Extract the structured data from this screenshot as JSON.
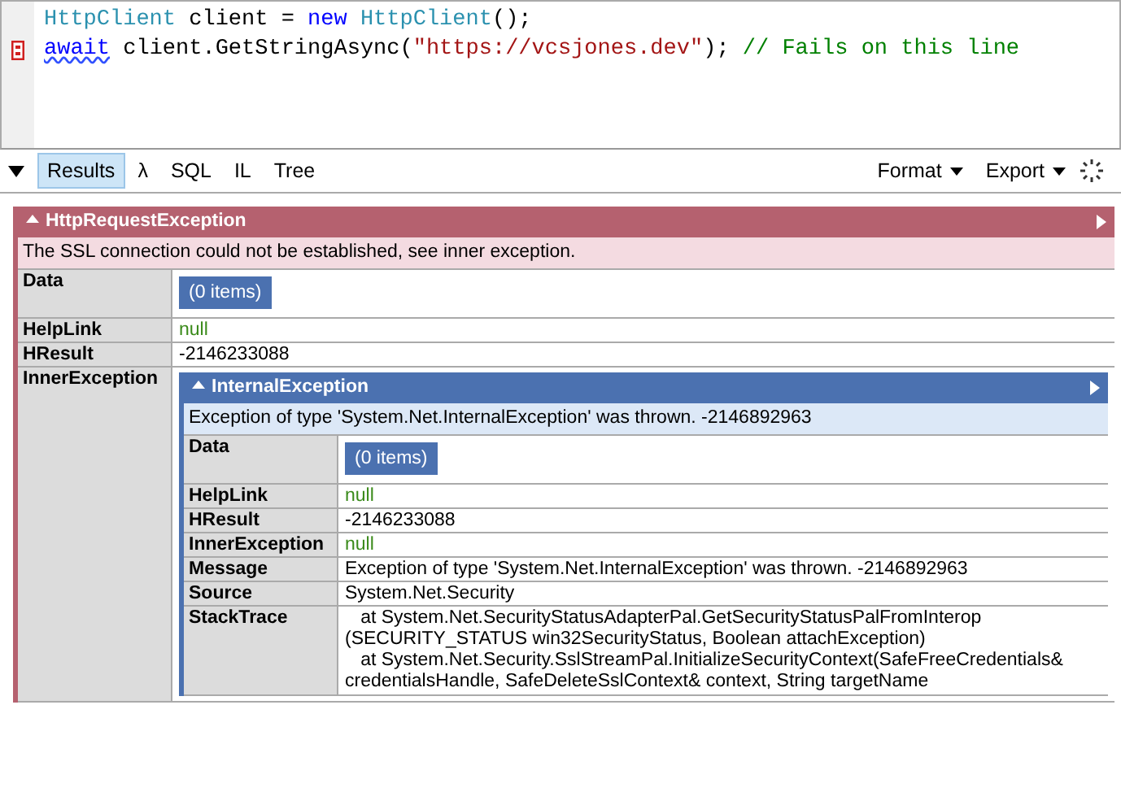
{
  "editor": {
    "lines": [
      {
        "breakpoint": false,
        "tokens": [
          {
            "text": "HttpClient",
            "kind": "type",
            "squiggle": false
          },
          {
            "text": " client = ",
            "kind": "plain",
            "squiggle": false
          },
          {
            "text": "new",
            "kind": "keyword",
            "squiggle": false
          },
          {
            "text": " HttpClient",
            "kind": "type",
            "squiggle": false
          },
          {
            "text": "();",
            "kind": "plain",
            "squiggle": false
          }
        ]
      },
      {
        "breakpoint": true,
        "tokens": [
          {
            "text": "await",
            "kind": "keyword",
            "squiggle": true
          },
          {
            "text": " client.GetStringAsync(",
            "kind": "plain",
            "squiggle": false
          },
          {
            "text": "\"https://vcsjones.dev\"",
            "kind": "string",
            "squiggle": false
          },
          {
            "text": "); ",
            "kind": "plain",
            "squiggle": false
          },
          {
            "text": "// Fails on this line",
            "kind": "comment",
            "squiggle": false
          }
        ]
      }
    ]
  },
  "toolbar": {
    "tabs": [
      {
        "label": "Results",
        "selected": true
      },
      {
        "label": "λ",
        "selected": false
      },
      {
        "label": "SQL",
        "selected": false
      },
      {
        "label": "IL",
        "selected": false
      },
      {
        "label": "Tree",
        "selected": false
      }
    ],
    "menus": [
      "Format",
      "Export"
    ]
  },
  "exception": {
    "title": "HttpRequestException",
    "message": "The SSL connection could not be established, see inner exception.",
    "rows": [
      {
        "label": "Data",
        "kind": "collection",
        "value": "(0 items)"
      },
      {
        "label": "HelpLink",
        "kind": "null",
        "value": "null"
      },
      {
        "label": "HResult",
        "kind": "text",
        "value": "-2146233088"
      },
      {
        "label": "InnerException",
        "kind": "exception",
        "value": "",
        "exception": {
          "title": "InternalException",
          "message": "Exception of type 'System.Net.InternalException' was thrown. -2146892963",
          "rows": [
            {
              "label": "Data",
              "kind": "collection",
              "value": "(0 items)"
            },
            {
              "label": "HelpLink",
              "kind": "null",
              "value": "null"
            },
            {
              "label": "HResult",
              "kind": "text",
              "value": "-2146233088"
            },
            {
              "label": "InnerException",
              "kind": "null",
              "value": "null"
            },
            {
              "label": "Message",
              "kind": "text",
              "value": "Exception of type 'System.Net.InternalException' was thrown. -2146892963"
            },
            {
              "label": "Source",
              "kind": "text",
              "value": "System.Net.Security"
            },
            {
              "label": "StackTrace",
              "kind": "lines",
              "lines": [
                "   at System.Net.SecurityStatusAdapterPal.GetSecurityStatusPalFromInterop",
                "(SECURITY_STATUS win32SecurityStatus, Boolean attachException)",
                "   at System.Net.Security.SslStreamPal.InitializeSecurityContext(SafeFreeCredentials&",
                "credentialsHandle, SafeDeleteSslContext& context, String targetName"
              ]
            }
          ]
        }
      }
    ]
  }
}
